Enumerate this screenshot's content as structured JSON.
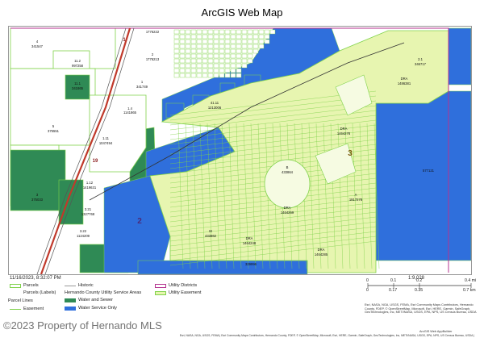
{
  "header": {
    "title": "ArcGIS Web Map"
  },
  "map": {
    "colors": {
      "water_service_only": "#2f6fdc",
      "water_and_sewer": "#2f8a55",
      "parcel_outline": "#7fd24a",
      "easement_fill": "#e7f5b0",
      "utility_district": "#b4338f",
      "basemap": "#ffffff",
      "lake": "#bfe0f0"
    },
    "parcel_labels": [
      {
        "id": "lbl-1",
        "text": "4"
      },
      {
        "id": "lbl-2",
        "text": "341547"
      },
      {
        "id": "lbl-3",
        "text": "11.2"
      },
      {
        "id": "lbl-4",
        "text": "997258"
      },
      {
        "id": "lbl-5",
        "text": "11.1"
      },
      {
        "id": "lbl-6",
        "text": "341865"
      },
      {
        "id": "lbl-7",
        "text": "1.4"
      },
      {
        "id": "lbl-8",
        "text": "1141865"
      },
      {
        "id": "lbl-9",
        "text": "5"
      },
      {
        "id": "lbl-10",
        "text": "375551"
      },
      {
        "id": "lbl-11",
        "text": "1776222"
      },
      {
        "id": "lbl-12",
        "text": "2"
      },
      {
        "id": "lbl-13",
        "text": "1776213"
      },
      {
        "id": "lbl-14",
        "text": "1"
      },
      {
        "id": "lbl-15",
        "text": "341749"
      },
      {
        "id": "lbl-16",
        "text": "41.11"
      },
      {
        "id": "lbl-17",
        "text": "1213006"
      },
      {
        "id": "lbl-18",
        "text": "DRA"
      },
      {
        "id": "lbl-19",
        "text": "1486381"
      },
      {
        "id": "lbl-20",
        "text": "2.1"
      },
      {
        "id": "lbl-21",
        "text": "346717"
      },
      {
        "id": "lbl-22",
        "text": "DRA"
      },
      {
        "id": "lbl-23",
        "text": "1464276"
      },
      {
        "id": "lbl-24",
        "text": "B"
      },
      {
        "id": "lbl-25",
        "text": "433864"
      },
      {
        "id": "lbl-26",
        "text": "DRA"
      },
      {
        "id": "lbl-27",
        "text": "1464269"
      },
      {
        "id": "lbl-28",
        "text": "M"
      },
      {
        "id": "lbl-29",
        "text": "433862"
      },
      {
        "id": "lbl-30",
        "text": "DRA"
      },
      {
        "id": "lbl-31",
        "text": "1464248"
      },
      {
        "id": "lbl-32",
        "text": "DRA"
      },
      {
        "id": "lbl-33",
        "text": "1464285"
      },
      {
        "id": "lbl-34",
        "text": "329996"
      },
      {
        "id": "lbl-35",
        "text": "3.21"
      },
      {
        "id": "lbl-36",
        "text": "1327768"
      },
      {
        "id": "lbl-37",
        "text": "3.22"
      },
      {
        "id": "lbl-38",
        "text": "1124209"
      },
      {
        "id": "lbl-39",
        "text": "1.12"
      },
      {
        "id": "lbl-40",
        "text": "1419631"
      },
      {
        "id": "lbl-41",
        "text": "1.11"
      },
      {
        "id": "lbl-42",
        "text": "1047494"
      },
      {
        "id": "lbl-43",
        "text": "3"
      },
      {
        "id": "lbl-44",
        "text": "375033"
      },
      {
        "id": "lbl-45",
        "text": "577121"
      },
      {
        "id": "lbl-46",
        "text": "A"
      },
      {
        "id": "lbl-47",
        "text": "1917278"
      }
    ],
    "area_labels": [
      {
        "id": "area-2",
        "text": "2"
      },
      {
        "id": "area-3",
        "text": "3"
      }
    ],
    "road_labels": [
      {
        "id": "road-1",
        "text": "1"
      },
      {
        "id": "road-19",
        "text": "19"
      }
    ]
  },
  "footer": {
    "date": "11/16/2023, 8:32:07 PM",
    "scale_ratio": "1:9,028",
    "scale_ticks": [
      "0",
      "0.1",
      "0.2",
      "0.4 mi"
    ],
    "scale_ticks_km": [
      "0",
      "0.17",
      "0.35",
      "0.7 km"
    ],
    "attribution": "Esri, NASA, NGA, USGS, FEMA, Esri Community Maps Contributors, Hernando County, FDEP, © OpenStreetMap, Microsoft, Esri, HERE, Garmin, SafeGraph, GeoTechnologies, Inc, METI/NASA, USGS, EPA, NPS, US Census Bureau, USDA",
    "attribution_bottom": "Esri, NASA, NGA, USGS, FEMA | Esri Community Maps Contributors, Hernando County, FDEP, © OpenStreetMap, Microsoft, Esri, HERE, Garmin, SafeGraph, GeoTechnologies, Inc, METI/NASA, USGS, EPA, NPS, US Census Bureau, USDA |",
    "powered_by": "ArcGIS Web AppBuilder"
  },
  "legend": {
    "items": [
      {
        "id": "parcels",
        "label": "Parcels",
        "kind": "box",
        "color": "#7fd24a"
      },
      {
        "id": "parcels-labels",
        "label": "Parcels (Labels)",
        "kind": "none",
        "color": ""
      },
      {
        "id": "parcel-lines",
        "label": "Parcel Lines",
        "kind": "none",
        "color": ""
      },
      {
        "id": "easement",
        "label": "Easement",
        "kind": "line",
        "color": "#7fd24a"
      },
      {
        "id": "historic",
        "label": "Historic",
        "kind": "line",
        "color": "#999999"
      },
      {
        "id": "hernando-county-utility-service-areas",
        "label": "Hernando County Utility Service Areas",
        "kind": "none",
        "color": ""
      },
      {
        "id": "water-and-sewer",
        "label": "Water and Sewer",
        "kind": "fill",
        "color": "#2f8a55"
      },
      {
        "id": "water-service-only",
        "label": "Water Service Only",
        "kind": "fill",
        "color": "#2f6fdc"
      },
      {
        "id": "utility-districts",
        "label": "Utility Districts",
        "kind": "box",
        "color": "#b4338f"
      },
      {
        "id": "utility-easement",
        "label": "Utility Easement",
        "kind": "fill",
        "color": "#e7f5b0"
      }
    ]
  },
  "watermark": {
    "text": "©2023 Property of Hernando MLS"
  }
}
